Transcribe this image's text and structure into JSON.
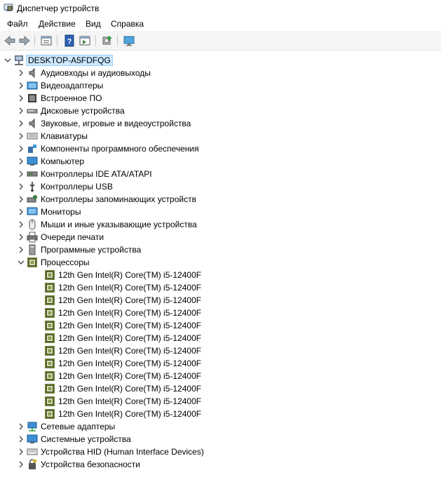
{
  "window": {
    "title": "Диспетчер устройств"
  },
  "menu": [
    "Файл",
    "Действие",
    "Вид",
    "Справка"
  ],
  "tree": {
    "root": "DESKTOP-A5FDFQG",
    "categories_before": [
      "Аудиовходы и аудиовыходы",
      "Видеоадаптеры",
      "Встроенное ПО",
      "Дисковые устройства",
      "Звуковые, игровые и видеоустройства",
      "Клавиатуры",
      "Компоненты программного обеспечения",
      "Компьютер",
      "Контроллеры IDE ATA/ATAPI",
      "Контроллеры USB",
      "Контроллеры запоминающих устройств",
      "Мониторы",
      "Мыши и иные указывающие устройства",
      "Очереди печати",
      "Программные устройства"
    ],
    "processors_label": "Процессоры",
    "processors": [
      "12th Gen Intel(R) Core(TM) i5-12400F",
      "12th Gen Intel(R) Core(TM) i5-12400F",
      "12th Gen Intel(R) Core(TM) i5-12400F",
      "12th Gen Intel(R) Core(TM) i5-12400F",
      "12th Gen Intel(R) Core(TM) i5-12400F",
      "12th Gen Intel(R) Core(TM) i5-12400F",
      "12th Gen Intel(R) Core(TM) i5-12400F",
      "12th Gen Intel(R) Core(TM) i5-12400F",
      "12th Gen Intel(R) Core(TM) i5-12400F",
      "12th Gen Intel(R) Core(TM) i5-12400F",
      "12th Gen Intel(R) Core(TM) i5-12400F",
      "12th Gen Intel(R) Core(TM) i5-12400F"
    ],
    "categories_after": [
      "Сетевые адаптеры",
      "Системные устройства",
      "Устройства HID (Human Interface Devices)",
      "Устройства безопасности"
    ]
  },
  "colors": {
    "selection": "#cce8ff",
    "selection_border": "#99d1ff"
  }
}
